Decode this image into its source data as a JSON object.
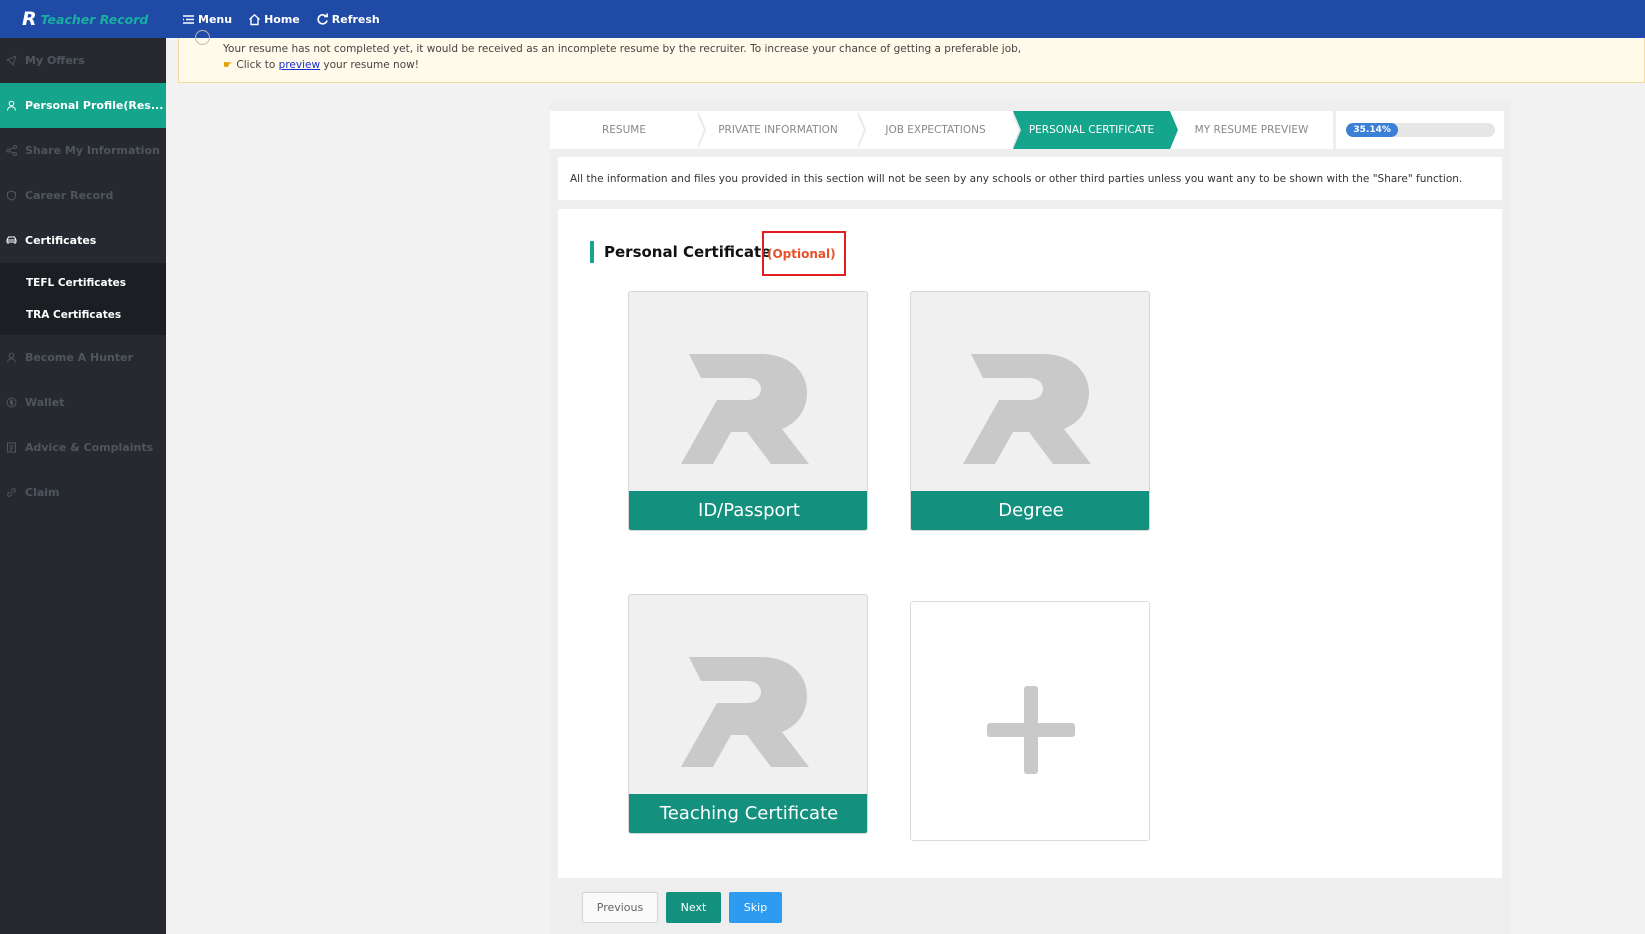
{
  "brand": {
    "logo_letter": "R",
    "name": "Teacher Record"
  },
  "topnav": {
    "menu": "Menu",
    "home": "Home",
    "refresh": "Refresh"
  },
  "sidebar": {
    "items": [
      {
        "label": "My Offers",
        "icon": "send-icon"
      },
      {
        "label": "Personal Profile(Res...",
        "icon": "user-icon"
      },
      {
        "label": "Share My Information",
        "icon": "share-icon"
      },
      {
        "label": "Career Record",
        "icon": "shield-icon"
      },
      {
        "label": "Certificates",
        "icon": "car-icon"
      },
      {
        "label": "Become A Hunter",
        "icon": "person-icon"
      },
      {
        "label": "Wallet",
        "icon": "dollar-icon"
      },
      {
        "label": "Advice & Complaints",
        "icon": "document-icon"
      },
      {
        "label": "Claim",
        "icon": "link-icon"
      }
    ],
    "sub_items": [
      "TEFL Certificates",
      "TRA Certificates"
    ]
  },
  "notice": {
    "line1": "Your resume has not completed yet, it would be received as an incomplete resume by the recruiter. To increase your chance of getting a preferable job,",
    "line2_prefix": "Click to",
    "line2_link": "preview",
    "line2_suffix": "your resume now!"
  },
  "steps": [
    {
      "label": "RESUME",
      "active": false
    },
    {
      "label": "PRIVATE INFORMATION",
      "active": false
    },
    {
      "label": "JOB EXPECTATIONS",
      "active": false
    },
    {
      "label": "PERSONAL CERTIFICATE",
      "active": true
    },
    {
      "label": "MY RESUME PREVIEW",
      "active": false
    }
  ],
  "progress": {
    "label": "35.14%",
    "value": 0.3514
  },
  "info_text": "All the information and files you provided in this section will not be seen by any schools or other third parties unless you want any to be shown with the \"Share\" function.",
  "section": {
    "title": "Personal Certificate",
    "optional": "(Optional)"
  },
  "cards": [
    "ID/Passport",
    "Degree",
    "Teaching Certificate"
  ],
  "buttons": {
    "previous": "Previous",
    "next": "Next",
    "skip": "Skip"
  },
  "colors": {
    "topbar": "#1f4aa6",
    "accent": "#14a58c",
    "card_label": "#14907e",
    "skip": "#2c9bf0",
    "optional": "#e8502a"
  }
}
